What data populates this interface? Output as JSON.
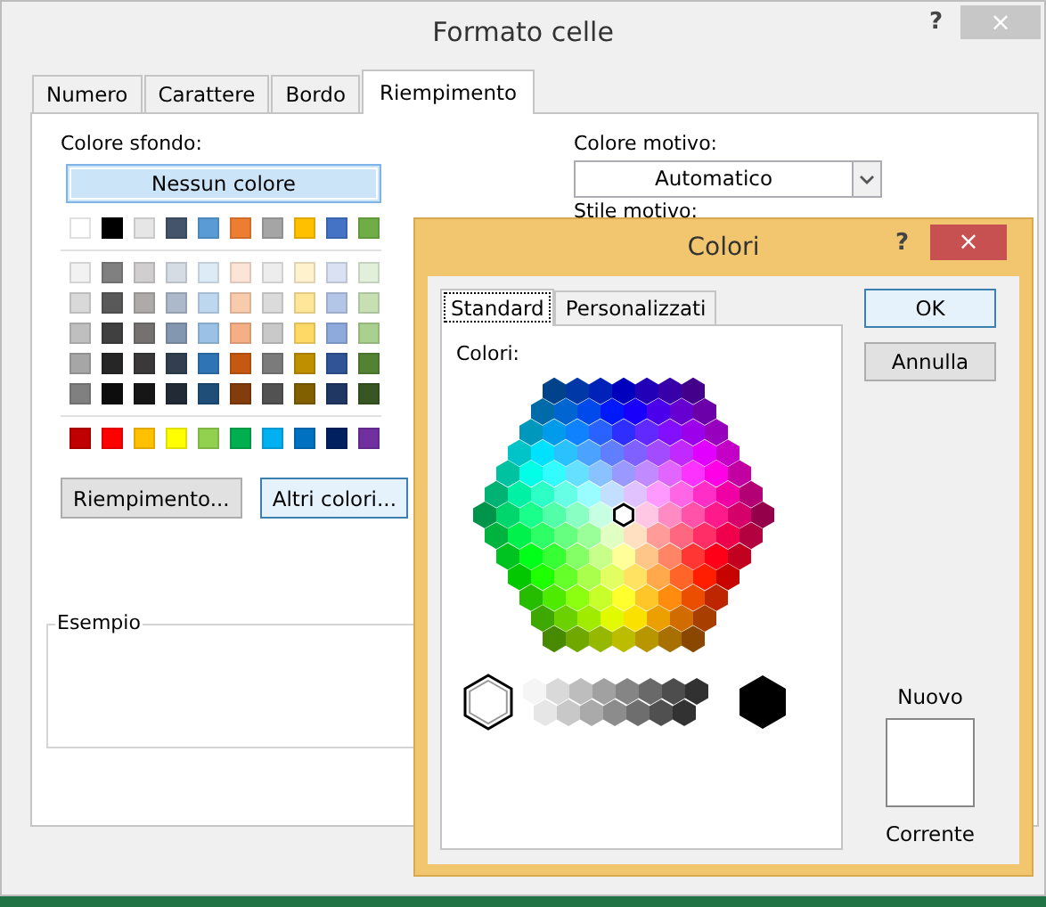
{
  "dialog": {
    "title": "Formato celle",
    "help": "?",
    "close": "×"
  },
  "tabs": [
    {
      "label": "Numero",
      "selected": false
    },
    {
      "label": "Carattere",
      "selected": false
    },
    {
      "label": "Bordo",
      "selected": false
    },
    {
      "label": "Riempimento",
      "selected": true
    }
  ],
  "fill": {
    "background_label": "Colore sfondo:",
    "no_color": {
      "label": "Nessun colore",
      "selected": true
    },
    "theme_colors": [
      {
        "color": "#ffffff",
        "selected": false
      },
      {
        "color": "#000000",
        "selected": false
      },
      {
        "color": "#e7e6e6",
        "selected": false
      },
      {
        "color": "#44546a",
        "selected": false
      },
      {
        "color": "#5b9bd5",
        "selected": false
      },
      {
        "color": "#ed7d31",
        "selected": false
      },
      {
        "color": "#a5a5a5",
        "selected": false
      },
      {
        "color": "#ffc000",
        "selected": false
      },
      {
        "color": "#4472c4",
        "selected": false
      },
      {
        "color": "#70ad47",
        "selected": false
      }
    ],
    "tints": [
      [
        {
          "color": "#f2f2f2",
          "selected": false
        },
        {
          "color": "#808080",
          "selected": false
        },
        {
          "color": "#d0cece",
          "selected": false
        },
        {
          "color": "#d6dce4",
          "selected": false
        },
        {
          "color": "#ddebf7",
          "selected": false
        },
        {
          "color": "#fce4d6",
          "selected": false
        },
        {
          "color": "#ededed",
          "selected": false
        },
        {
          "color": "#fff2cc",
          "selected": false
        },
        {
          "color": "#d9e1f2",
          "selected": false
        },
        {
          "color": "#e2efda",
          "selected": false
        }
      ],
      [
        {
          "color": "#d9d9d9",
          "selected": false
        },
        {
          "color": "#595959",
          "selected": false
        },
        {
          "color": "#aeaaaa",
          "selected": false
        },
        {
          "color": "#acb9ca",
          "selected": false
        },
        {
          "color": "#bdd7ee",
          "selected": false
        },
        {
          "color": "#f8cbad",
          "selected": false
        },
        {
          "color": "#dbdbdb",
          "selected": false
        },
        {
          "color": "#ffe699",
          "selected": false
        },
        {
          "color": "#b4c6e7",
          "selected": false
        },
        {
          "color": "#c6e0b4",
          "selected": false
        }
      ],
      [
        {
          "color": "#bfbfbf",
          "selected": false
        },
        {
          "color": "#404040",
          "selected": false
        },
        {
          "color": "#757171",
          "selected": false
        },
        {
          "color": "#8497b0",
          "selected": false
        },
        {
          "color": "#9bc2e6",
          "selected": false
        },
        {
          "color": "#f4b084",
          "selected": false
        },
        {
          "color": "#c9c9c9",
          "selected": false
        },
        {
          "color": "#ffd966",
          "selected": false
        },
        {
          "color": "#8ea9db",
          "selected": false
        },
        {
          "color": "#a9d08e",
          "selected": false
        }
      ],
      [
        {
          "color": "#a6a6a6",
          "selected": false
        },
        {
          "color": "#262626",
          "selected": false
        },
        {
          "color": "#3a3838",
          "selected": false
        },
        {
          "color": "#333f4f",
          "selected": false
        },
        {
          "color": "#2f75b5",
          "selected": false
        },
        {
          "color": "#c65911",
          "selected": false
        },
        {
          "color": "#7b7b7b",
          "selected": false
        },
        {
          "color": "#bf8f00",
          "selected": false
        },
        {
          "color": "#305496",
          "selected": false
        },
        {
          "color": "#548235",
          "selected": false
        }
      ],
      [
        {
          "color": "#808080",
          "selected": false
        },
        {
          "color": "#0d0d0d",
          "selected": false
        },
        {
          "color": "#161616",
          "selected": false
        },
        {
          "color": "#222b35",
          "selected": false
        },
        {
          "color": "#1f4e78",
          "selected": false
        },
        {
          "color": "#833c0c",
          "selected": false
        },
        {
          "color": "#525252",
          "selected": false
        },
        {
          "color": "#806000",
          "selected": false
        },
        {
          "color": "#203764",
          "selected": false
        },
        {
          "color": "#375623",
          "selected": false
        }
      ]
    ],
    "standard_colors": [
      {
        "color": "#c00000",
        "selected": false
      },
      {
        "color": "#ff0000",
        "selected": false
      },
      {
        "color": "#ffc000",
        "selected": false
      },
      {
        "color": "#ffff00",
        "selected": false
      },
      {
        "color": "#92d050",
        "selected": false
      },
      {
        "color": "#00b050",
        "selected": false
      },
      {
        "color": "#00b0f0",
        "selected": false
      },
      {
        "color": "#0070c0",
        "selected": false
      },
      {
        "color": "#002060",
        "selected": false
      },
      {
        "color": "#7030a0",
        "selected": false
      }
    ],
    "buttons": [
      {
        "label": "Riempimento...",
        "default": false
      },
      {
        "label": "Altri colori...",
        "default": true
      }
    ]
  },
  "pattern": {
    "color_label": "Colore motivo:",
    "color_value": "Automatico",
    "style_label": "Stile motivo:"
  },
  "sample": {
    "label": "Esempio"
  },
  "colors_dialog": {
    "title": "Colori",
    "help": "?",
    "close": "×",
    "tabs": [
      {
        "label": "Standard",
        "selected": true
      },
      {
        "label": "Personalizzati",
        "selected": false
      }
    ],
    "palette_label": "Colori:",
    "buttons": [
      {
        "label": "OK",
        "default": true
      },
      {
        "label": "Annulla",
        "default": false
      }
    ],
    "new_label": "Nuovo",
    "current_label": "Corrente"
  }
}
